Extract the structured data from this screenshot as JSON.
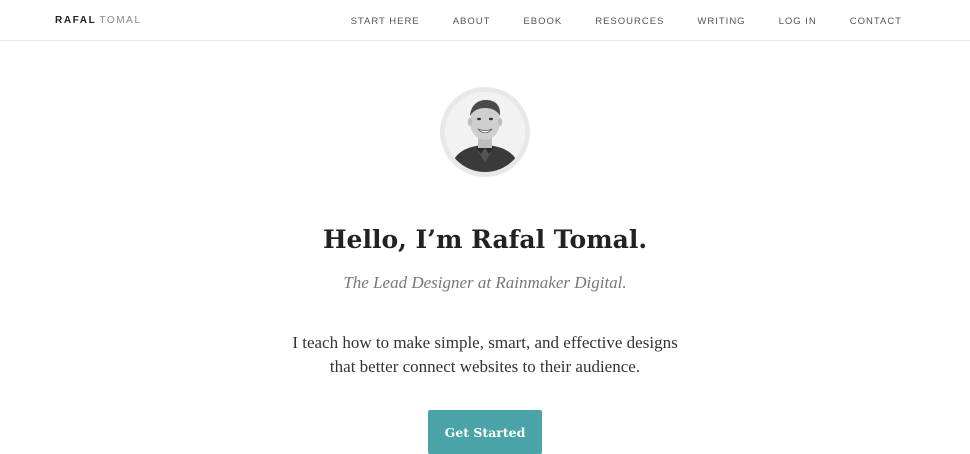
{
  "header": {
    "logo_first": "RAFAL",
    "logo_last": "TOMAL",
    "nav": [
      "START HERE",
      "ABOUT",
      "EBOOK",
      "RESOURCES",
      "WRITING",
      "LOG IN",
      "CONTACT"
    ]
  },
  "hero": {
    "headline": "Hello, I’m Rafal Tomal.",
    "subtitle": "The Lead Designer at Rainmaker Digital.",
    "intro_line1": "I teach how to make simple, smart, and effective designs",
    "intro_line2": "that better connect websites to their audience.",
    "cta_label": "Get Started"
  },
  "colors": {
    "accent": "#4aa3a6",
    "text": "#222222",
    "muted": "#777777"
  }
}
